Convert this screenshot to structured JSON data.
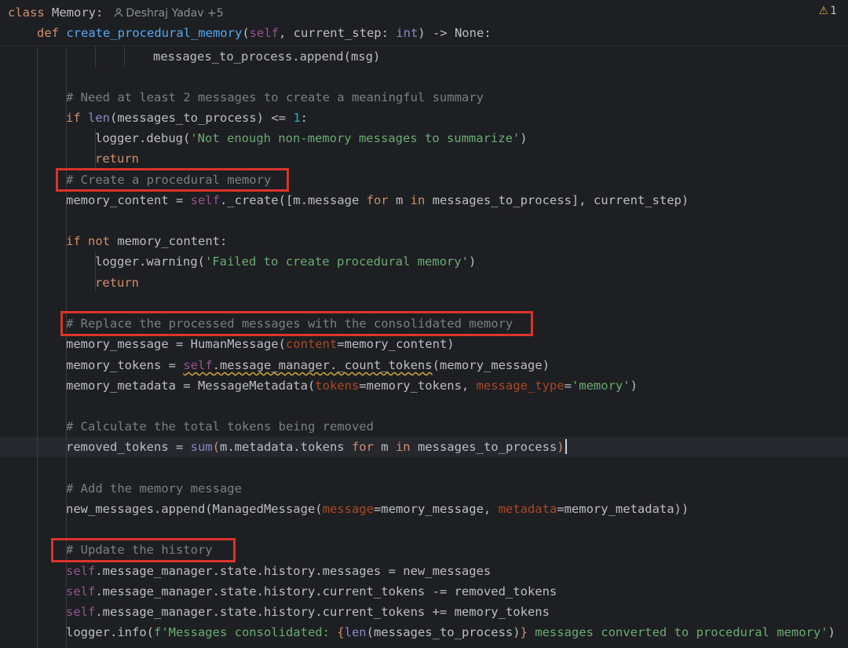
{
  "header": {
    "class_keyword": "class",
    "class_name": "Memory:",
    "author": "Deshraj Yadav +5",
    "warning_count": "1",
    "def_keyword": "def",
    "func_name": "create_procedural_memory",
    "signature_open": "(",
    "self_kw": "self",
    "params_rest": ", current_step: ",
    "param_type": "int",
    "signature_close": ") -> None:"
  },
  "code": {
    "l0": "messages_to_process.append(msg)",
    "c1": "# Need at least 2 messages to create a meaningful summary",
    "if1": "if",
    "len1": "len",
    "cond1": "(messages_to_process) <= ",
    "one": "1",
    "colon": ":",
    "logger_debug": "logger.debug(",
    "str_notenough": "'Not enough non-memory messages to summarize'",
    "close_paren": ")",
    "ret": "return",
    "c2": "# Create a procedural memory",
    "mc_assign": "memory_content = ",
    "self": "self",
    "create_call": "._create([m.message ",
    "for": "for",
    "m_sp": " m ",
    "in": "in",
    "create_tail": " messages_to_process], current_step)",
    "if": "if",
    "not": "not",
    "mc_cond": " memory_content:",
    "logger_warning": "logger.warning(",
    "str_failed": "'Failed to create procedural memory'",
    "c3": "# Replace the processed messages with the consolidated memory",
    "mm_assign": "memory_message = HumanMessage(",
    "p_content": "content",
    "mm_tail": "=memory_content)",
    "mt_assign": "memory_tokens = ",
    "mt_call": ".message_manager._count_tokens",
    "mt_tail": "(memory_message)",
    "md_assign": "memory_metadata = MessageMetadata(",
    "p_tokens": "tokens",
    "md_mid": "=memory_tokens, ",
    "p_message_type": "message_type",
    "eq": "=",
    "str_memory": "'memory'",
    "c4": "# Calculate the total tokens being removed",
    "rt_assign": "removed_tokens = ",
    "sum": "sum",
    "paren_open": "(",
    "rt_mid": "m.metadata.tokens ",
    "rt_tail": " messages_to_process",
    "c5": "# Add the memory message",
    "nm_call": "new_messages.append(ManagedMessage(",
    "p_message": "message",
    "nm_mid": "=memory_message, ",
    "p_metadata": "metadata",
    "nm_tail": "=memory_metadata))",
    "c6": "# Update the history",
    "h1": ".message_manager.state.history.messages = new_messages",
    "h2": ".message_manager.state.history.current_tokens -= removed_tokens",
    "h3": ".message_manager.state.history.current_tokens += memory_tokens",
    "info_call": "logger.info(",
    "f_open": "f'Messages consolidated: ",
    "brace_open": "{",
    "len": "len",
    "f_expr": "(messages_to_process)",
    "brace_close": "}",
    "f_close": " messages converted to procedural memory'"
  }
}
